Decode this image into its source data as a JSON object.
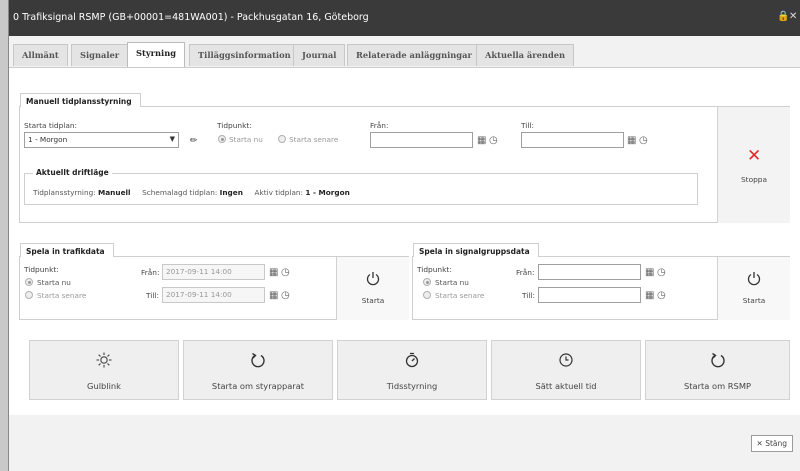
{
  "window": {
    "title": "0 Trafiksignal RSMP (GB+00001=481WA001) - Packhusgatan 16, Göteborg",
    "lock_icon": "lock-icon",
    "close_icon": "close-icon"
  },
  "tabs": [
    {
      "label": "Allmänt"
    },
    {
      "label": "Signaler"
    },
    {
      "label": "Styrning",
      "active": true
    },
    {
      "label": "Tilläggsinformation"
    },
    {
      "label": "Journal"
    },
    {
      "label": "Relaterade anläggningar"
    },
    {
      "label": "Aktuella ärenden"
    }
  ],
  "manual": {
    "title": "Manuell tidplansstyrning",
    "start_label": "Starta tidplan:",
    "start_value": "1 - Morgon",
    "time_label": "Tidpunkt:",
    "radio_now": "Starta nu",
    "radio_later": "Starta senare",
    "from_label": "Från:",
    "to_label": "Till:",
    "from_value": "",
    "to_value": "",
    "status": {
      "title": "Aktuellt driftläge",
      "k1": "Tidplansstyrning:",
      "v1": "Manuell",
      "k2": "Schemalagd tidplan:",
      "v2": "Ingen",
      "k3": "Aktiv tidplan:",
      "v3": "1 - Morgon"
    },
    "stop_label": "Stoppa",
    "stop_color": "#e02b2b"
  },
  "traffic": {
    "title": "Spela in trafikdata",
    "time_label": "Tidpunkt:",
    "radio_now": "Starta nu",
    "radio_later": "Starta senare",
    "from_label": "Från:",
    "to_label": "Till:",
    "from_value": "2017-09-11 14:00",
    "to_value": "2017-09-11 14:00",
    "start_label": "Starta"
  },
  "signal": {
    "title": "Spela in signalgruppsdata",
    "time_label": "Tidpunkt:",
    "radio_now": "Starta nu",
    "radio_later": "Starta senare",
    "from_label": "Från:",
    "to_label": "Till:",
    "from_value": "",
    "to_value": "",
    "start_label": "Starta"
  },
  "actions": [
    {
      "label": "Gulblink",
      "icon": "sun-icon"
    },
    {
      "label": "Starta om styrapparat",
      "icon": "restart-icon"
    },
    {
      "label": "Tidsstyrning",
      "icon": "timer-icon"
    },
    {
      "label": "Sätt aktuell tid",
      "icon": "clock-icon"
    },
    {
      "label": "Starta om RSMP",
      "icon": "restart-icon"
    }
  ],
  "footer": {
    "close_label": "Stäng"
  }
}
